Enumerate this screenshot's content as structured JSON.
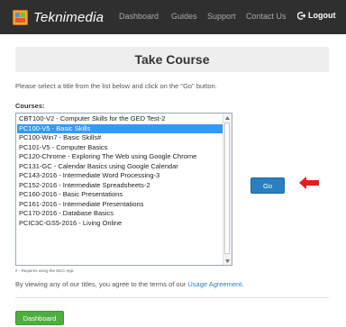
{
  "navbar": {
    "brand": "Teknimedia",
    "links": [
      "Dashboard",
      "Guides",
      "Support",
      "Contact Us"
    ],
    "logout_label": "Logout",
    "logout_icon": "logout-icon"
  },
  "page": {
    "title": "Take Course",
    "instructions": "Please select a title from the list below and click on the \"Go\" button.",
    "courses_label": "Courses:",
    "courses": [
      "CBT100-V2 - Computer Skills for the GED Test-2",
      "PC100-V5 - Basic Skills",
      "PC100-Win7 - Basic Skills#",
      "PC101-V5 - Computer Basics",
      "PC120-Chrome - Exploring The Web using Google Chrome",
      "PC131-GC - Calendar Basics using Google Calendar",
      "PC143-2016 - Intermediate Word Processing-3",
      "PC152-2016 - Intermediate Spreadsheets-2",
      "PC160-2016 - Basic Presentations",
      "PC161-2016 - Intermediate Presentations",
      "PC170-2016 - Database Basics",
      "PCIC3C-GS5-2016 - Living Online"
    ],
    "selected_course": "PC100-V5 - Basic Skills",
    "go_label": "Go",
    "footnote": "# - Requires using the WLC App.",
    "terms_prefix": "By viewing any of our titles, you agree to the terms of our ",
    "terms_link": "Usage Agreement",
    "terms_suffix": ".",
    "dashboard_label": "Dashboard"
  },
  "colors": {
    "navbar_bg": "#2f2f2f",
    "selection": "#3399ff",
    "go_button": "#2a7fc0",
    "dashboard_button": "#4cae3c",
    "arrow": "#e02020"
  }
}
